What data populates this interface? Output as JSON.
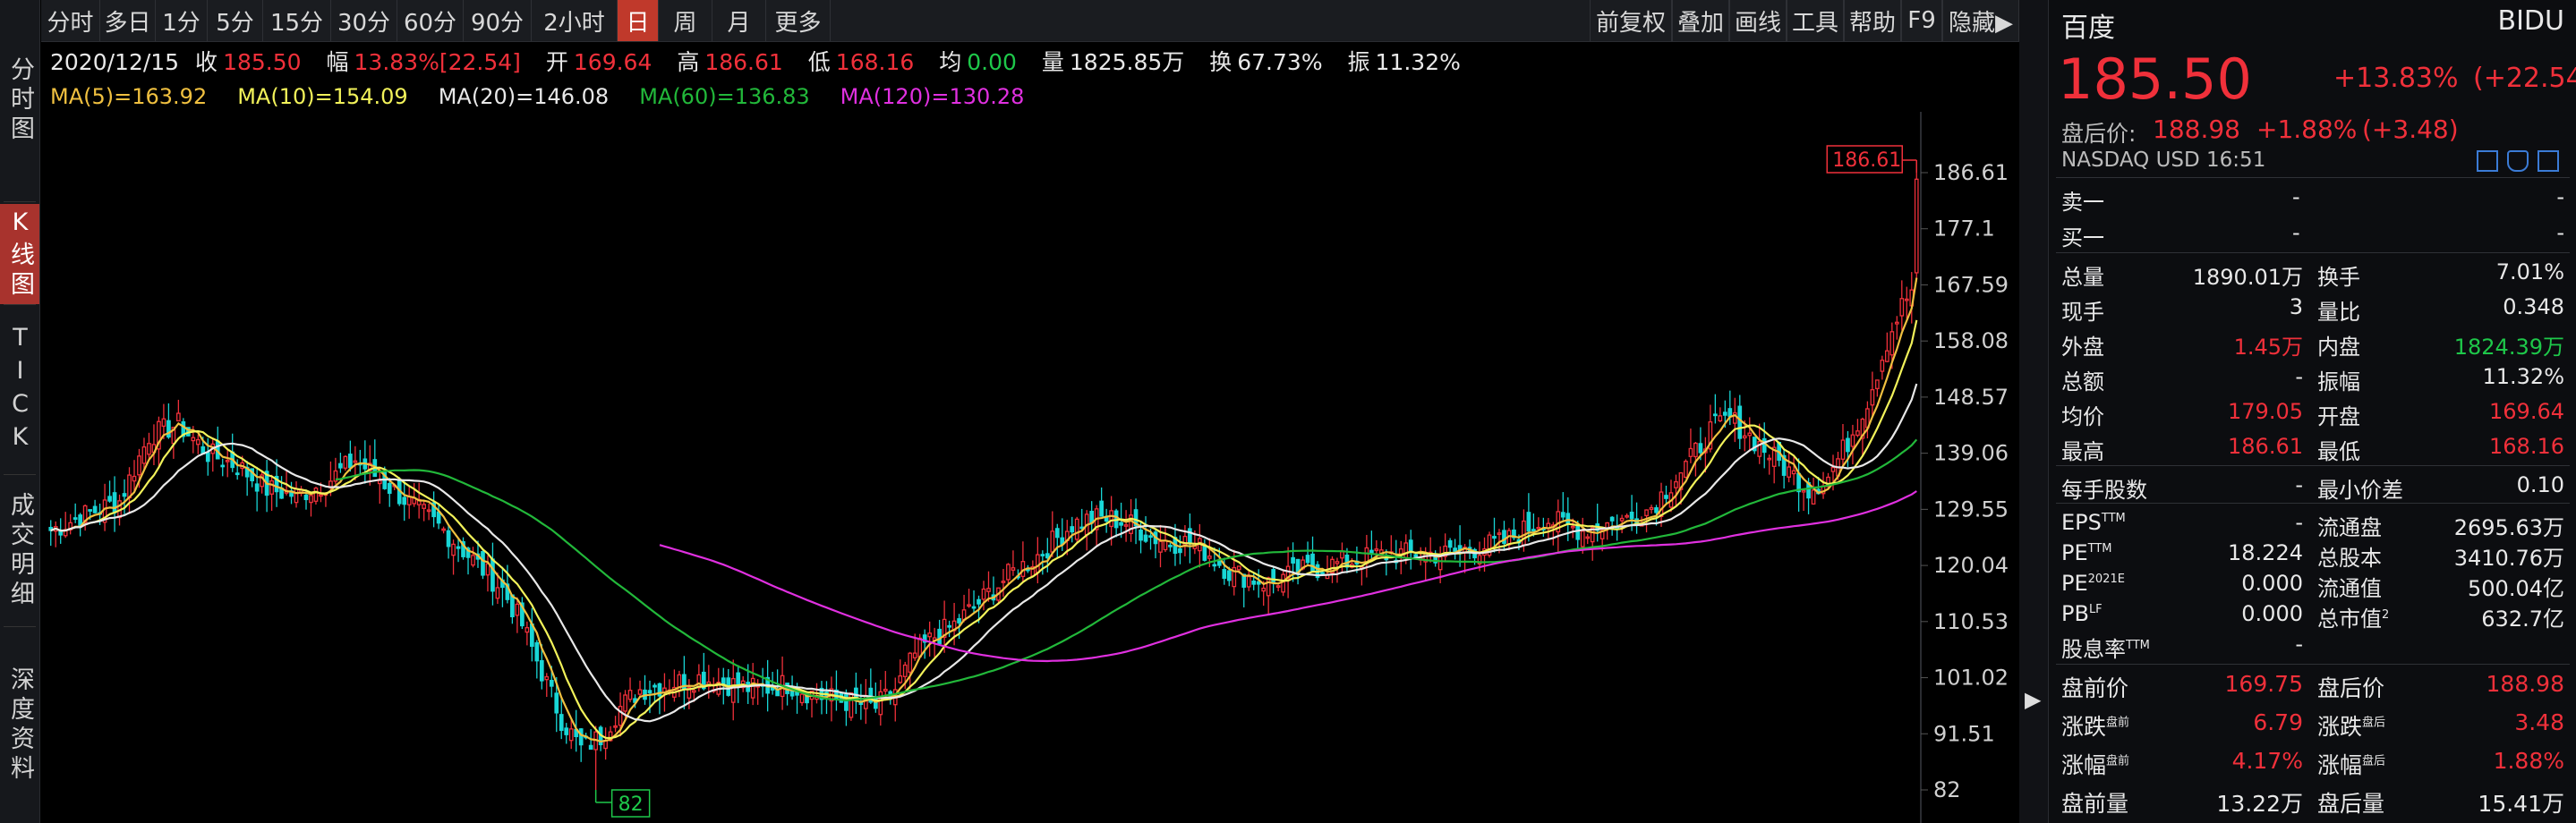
{
  "sidebar": {
    "tabs": [
      {
        "label": "分时图",
        "active": false
      },
      {
        "label": "K线图",
        "active": true
      },
      {
        "label": "TICK",
        "active": false
      },
      {
        "label": "成交明细",
        "active": false
      },
      {
        "label": "深度资料",
        "active": false
      }
    ]
  },
  "toolbar": {
    "periods": [
      "分时",
      "多日",
      "1分",
      "5分",
      "15分",
      "30分",
      "60分",
      "90分",
      "2小时",
      "日",
      "周",
      "月",
      "更多"
    ],
    "active_period": "日",
    "tools": [
      "前复权",
      "叠加",
      "画线",
      "工具",
      "帮助",
      "F9",
      "隐藏▶"
    ]
  },
  "quote": {
    "date": "2020/12/15",
    "close_label": "收",
    "close": "185.50",
    "change_label": "幅",
    "change": "13.83%[22.54]",
    "open_label": "开",
    "open": "169.64",
    "high_label": "高",
    "high": "186.61",
    "low_label": "低",
    "low": "168.16",
    "avg_label": "均",
    "avg": "0.00",
    "vol_label": "量",
    "vol": "1825.85万",
    "turnover_label": "换",
    "turnover": "67.73%",
    "amp_label": "振",
    "amp": "11.32%"
  },
  "ma": [
    {
      "text": "MA(5)=163.92",
      "color": "#f0c040"
    },
    {
      "text": "MA(10)=154.09",
      "color": "#f2f25a"
    },
    {
      "text": "MA(20)=146.08",
      "color": "#e8e8e8"
    },
    {
      "text": "MA(60)=136.83",
      "color": "#22b83a"
    },
    {
      "text": "MA(120)=130.28",
      "color": "#e030e0"
    }
  ],
  "chart_data": {
    "type": "candlestick",
    "y_ticks": [
      "186.61",
      "177.1",
      "167.59",
      "158.08",
      "148.57",
      "139.06",
      "129.55",
      "120.04",
      "110.53",
      "101.02",
      "91.51",
      "82"
    ],
    "ylim": [
      82,
      186.61
    ],
    "max_label": "186.61",
    "min_label": "82",
    "series": [
      {
        "name": "MA(5)",
        "color": "#f0c040"
      },
      {
        "name": "MA(10)",
        "color": "#f2f25a"
      },
      {
        "name": "MA(20)",
        "color": "#e8e8e8"
      },
      {
        "name": "MA(60)",
        "color": "#22b83a"
      },
      {
        "name": "MA(120)",
        "color": "#e030e0"
      }
    ],
    "close_anchors": [
      [
        0,
        126
      ],
      [
        8,
        129
      ],
      [
        14,
        131
      ],
      [
        20,
        142
      ],
      [
        26,
        144
      ],
      [
        32,
        139
      ],
      [
        38,
        137
      ],
      [
        44,
        133
      ],
      [
        50,
        132
      ],
      [
        56,
        134
      ],
      [
        62,
        138
      ],
      [
        68,
        134
      ],
      [
        74,
        130
      ],
      [
        80,
        126
      ],
      [
        86,
        121
      ],
      [
        92,
        116
      ],
      [
        96,
        110
      ],
      [
        100,
        102
      ],
      [
        104,
        94
      ],
      [
        108,
        89
      ],
      [
        112,
        91
      ],
      [
        116,
        96
      ],
      [
        120,
        99
      ],
      [
        126,
        100
      ],
      [
        132,
        101
      ],
      [
        138,
        100
      ],
      [
        144,
        99
      ],
      [
        150,
        100
      ],
      [
        156,
        98
      ],
      [
        162,
        97
      ],
      [
        168,
        96
      ],
      [
        172,
        99
      ],
      [
        176,
        105
      ],
      [
        180,
        108
      ],
      [
        184,
        110
      ],
      [
        188,
        113
      ],
      [
        192,
        116
      ],
      [
        196,
        119
      ],
      [
        200,
        121
      ],
      [
        204,
        124
      ],
      [
        208,
        127
      ],
      [
        212,
        128
      ],
      [
        216,
        128
      ],
      [
        220,
        127
      ],
      [
        224,
        125
      ],
      [
        228,
        124
      ],
      [
        232,
        124
      ],
      [
        236,
        122
      ],
      [
        240,
        119
      ],
      [
        244,
        118
      ],
      [
        248,
        117
      ],
      [
        254,
        119
      ],
      [
        260,
        120
      ],
      [
        266,
        121
      ],
      [
        272,
        122
      ],
      [
        278,
        122
      ],
      [
        284,
        122
      ],
      [
        290,
        123
      ],
      [
        296,
        124
      ],
      [
        300,
        126
      ],
      [
        304,
        128
      ],
      [
        308,
        127
      ],
      [
        312,
        126
      ],
      [
        316,
        127
      ],
      [
        322,
        128
      ],
      [
        326,
        130
      ],
      [
        330,
        134
      ],
      [
        334,
        138
      ],
      [
        338,
        143
      ],
      [
        342,
        145
      ],
      [
        346,
        142
      ],
      [
        350,
        139
      ],
      [
        354,
        136
      ],
      [
        358,
        133
      ],
      [
        362,
        135
      ],
      [
        366,
        141
      ],
      [
        370,
        148
      ],
      [
        374,
        158
      ],
      [
        377,
        164
      ],
      [
        380,
        168
      ]
    ],
    "last_candle": {
      "open": 169.64,
      "high": 186.61,
      "low": 168.16,
      "close": 185.5
    }
  },
  "quote_panel": {
    "name": "百度",
    "ticker": "BIDU",
    "price": "185.50",
    "change_pct": "+13.83%",
    "change_abs": "(+22.54)",
    "after_label": "盘后价:",
    "after_price": "188.98",
    "after_pct": "+1.88%",
    "after_abs": "(+3.48)",
    "exchange": "NASDAQ  USD  16:51",
    "sell1_label": "卖一",
    "sell1_value": "-",
    "sell1_vol": "-",
    "buy1_label": "买一",
    "buy1_value": "-",
    "buy1_vol": "-",
    "stats": [
      {
        "l1": "总量",
        "v1": "1890.01万",
        "c1": "#e8e8e8",
        "l2": "换手",
        "v2": "7.01%",
        "c2": "#e8e8e8"
      },
      {
        "l1": "现手",
        "v1": "3",
        "c1": "#e8e8e8",
        "l2": "量比",
        "v2": "0.348",
        "c2": "#e8e8e8"
      },
      {
        "l1": "外盘",
        "v1": "1.45万",
        "c1": "#f0303a",
        "l2": "内盘",
        "v2": "1824.39万",
        "c2": "#1ec84a"
      },
      {
        "l1": "总额",
        "v1": "-",
        "c1": "#e8e8e8",
        "l2": "振幅",
        "v2": "11.32%",
        "c2": "#e8e8e8"
      },
      {
        "l1": "均价",
        "v1": "179.05",
        "c1": "#f0303a",
        "l2": "开盘",
        "v2": "169.64",
        "c2": "#f0303a"
      },
      {
        "l1": "最高",
        "v1": "186.61",
        "c1": "#f0303a",
        "l2": "最低",
        "v2": "168.16",
        "c2": "#f0303a"
      }
    ],
    "lot": {
      "l1": "每手股数",
      "v1": "-",
      "l2": "最小价差",
      "v2": "0.10"
    },
    "fundamentals": [
      {
        "l1": "EPS",
        "s1": "TTM",
        "v1": "-",
        "l2": "流通盘",
        "s2": "",
        "v2": "2695.63万"
      },
      {
        "l1": "PE",
        "s1": "TTM",
        "v1": "18.224",
        "l2": "总股本",
        "s2": "",
        "v2": "3410.76万"
      },
      {
        "l1": "PE",
        "s1": "2021E",
        "v1": "0.000",
        "l2": "流通值",
        "s2": "",
        "v2": "500.04亿"
      },
      {
        "l1": "PB",
        "s1": "LF",
        "v1": "0.000",
        "l2": "总市值",
        "s2": "2",
        "v2": "632.7亿"
      },
      {
        "l1": "股息率",
        "s1": "TTM",
        "v1": "-",
        "l2": "",
        "s2": "",
        "v2": ""
      }
    ],
    "pre_post": [
      {
        "l1": "盘前价",
        "s1": "",
        "v1": "169.75",
        "c1": "#f0303a",
        "l2": "盘后价",
        "s2": "",
        "v2": "188.98",
        "c2": "#f0303a"
      },
      {
        "l1": "涨跌",
        "s1": "盘前",
        "v1": "6.79",
        "c1": "#f0303a",
        "l2": "涨跌",
        "s2": "盘后",
        "v2": "3.48",
        "c2": "#f0303a"
      },
      {
        "l1": "涨幅",
        "s1": "盘前",
        "v1": "4.17%",
        "c1": "#f0303a",
        "l2": "涨幅",
        "s2": "盘后",
        "v2": "1.88%",
        "c2": "#f0303a"
      },
      {
        "l1": "盘前量",
        "s1": "",
        "v1": "13.22万",
        "c1": "#e8e8e8",
        "l2": "盘后量",
        "s2": "",
        "v2": "15.41万",
        "c2": "#e8e8e8"
      }
    ]
  }
}
